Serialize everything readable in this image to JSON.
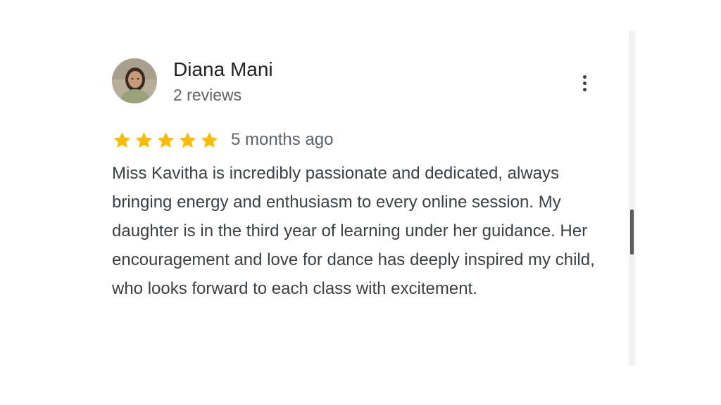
{
  "review": {
    "reviewer_name": "Diana Mani",
    "review_count": "2 reviews",
    "rating": 5,
    "rating_max": 5,
    "date": "5 months ago",
    "text": "Miss Kavitha is incredibly passionate and dedicated, always bringing energy and enthusiasm to every online session. My daughter is in the third year of learning under her guidance. Her encouragement and love for dance has deeply inspired my child, who looks forward to each class with excitement.",
    "avatar_icon": "reviewer-avatar",
    "menu_icon": "more-vert-icon"
  },
  "colors": {
    "star": "#F9BC05",
    "name": "#202124",
    "meta": "#5f6368",
    "body": "#3c4043",
    "scroll_thumb": "#5a5a5a",
    "scroll_track": "#f1f1f1"
  },
  "scroll": {
    "position_fraction": 0.54
  }
}
